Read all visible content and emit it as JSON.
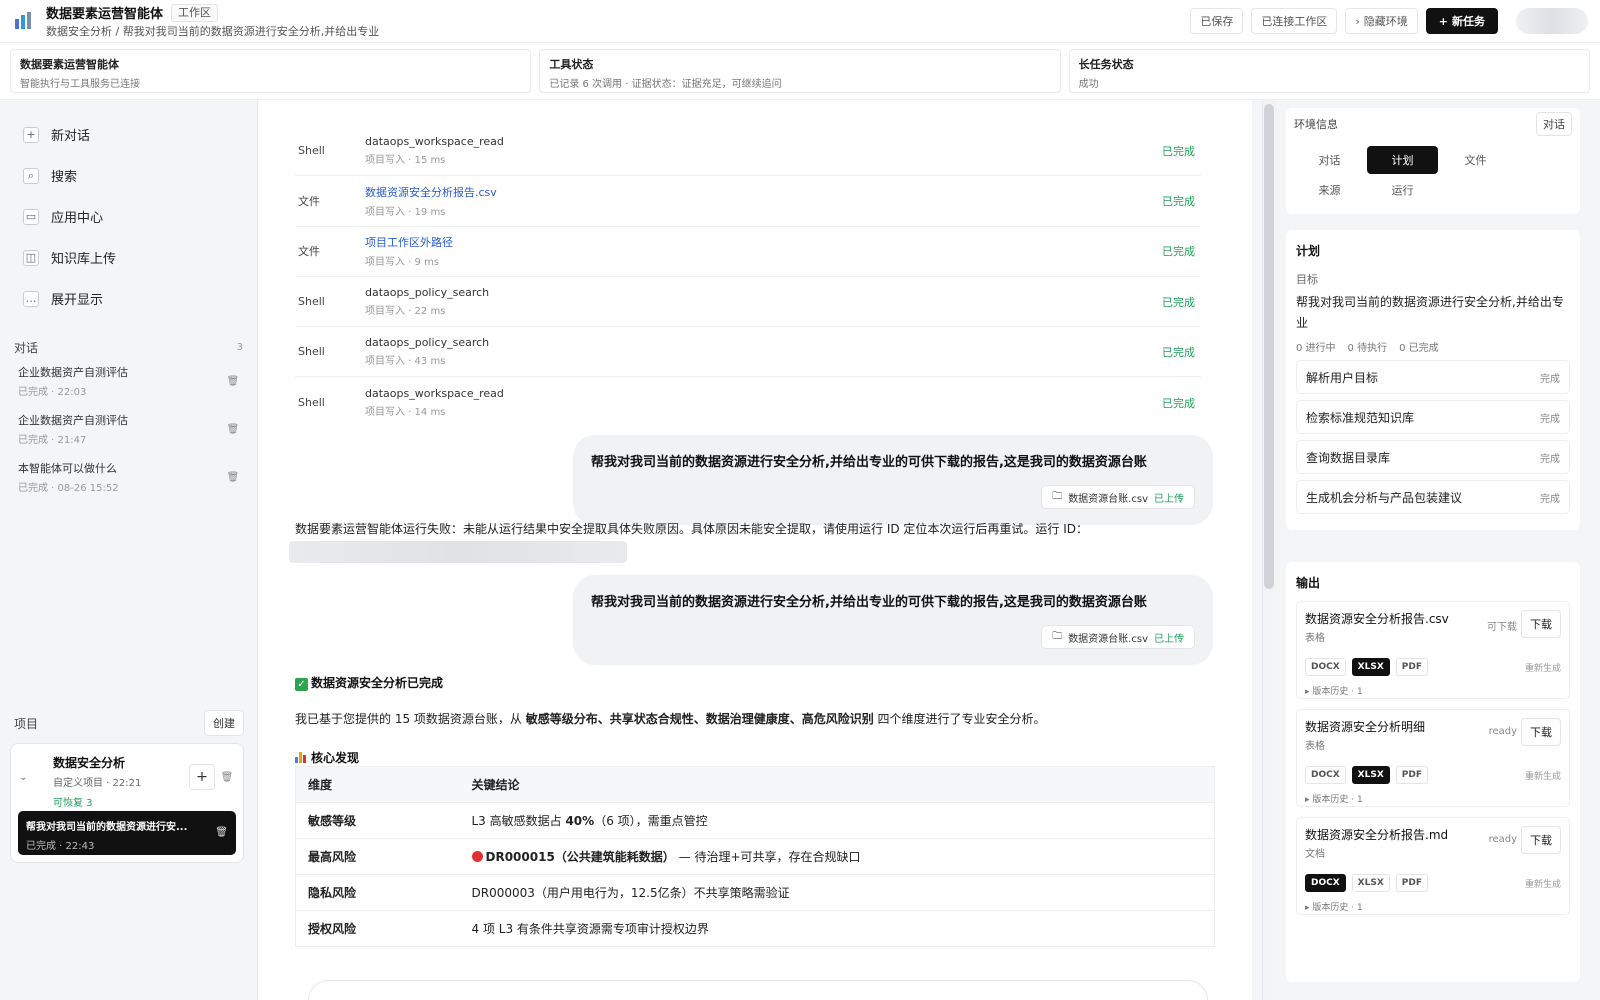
{
  "header": {
    "title": "数据要素运营智能体",
    "workspace_tag": "工作区",
    "breadcrumb": "数据安全分析 / 帮我对我司当前的数据资源进行安全分析,并给出专业",
    "saved": "已保存",
    "connected": "已连接工作区",
    "hide_env": "隐藏环境",
    "new_task": "新任务"
  },
  "status": {
    "agent": {
      "title": "数据要素运营智能体",
      "desc": "智能执行与工具服务已连接"
    },
    "tool": {
      "title": "工具状态",
      "desc": "已记录 6 次调用 · 证据状态：证据充足，可继续追问"
    },
    "task": {
      "title": "长任务状态",
      "desc": "成功"
    }
  },
  "sidebar": {
    "nav": [
      {
        "label": "新对话",
        "icon": "+"
      },
      {
        "label": "搜索",
        "icon": "⌕"
      },
      {
        "label": "应用中心",
        "icon": "▭"
      },
      {
        "label": "知识库上传",
        "icon": "◫"
      },
      {
        "label": "展开显示",
        "icon": "…"
      }
    ],
    "conversations_label": "对话",
    "conversations_count": "3",
    "conversations": [
      {
        "title": "企业数据资产自测评估",
        "sub": "已完成 · 22:03"
      },
      {
        "title": "企业数据资产自测评估",
        "sub": "已完成 · 21:47"
      },
      {
        "title": "本智能体可以做什么",
        "sub": "已完成 · 08-26 15:52"
      }
    ],
    "projects_label": "项目",
    "create": "创建",
    "project": {
      "name": "数据安全分析",
      "sub": "自定义项目 · 22:21",
      "recoverable": "可恢复 3",
      "run_title": "帮我对我司当前的数据资源进行安...",
      "run_sub": "已完成 · 22:43"
    }
  },
  "tools": [
    {
      "type": "Shell",
      "name": "dataops_workspace_read",
      "meta": "项目写入 · 15 ms",
      "status": "已完成",
      "link": false
    },
    {
      "type": "文件",
      "name": "数据资源安全分析报告.csv",
      "meta": "项目写入 · 19 ms",
      "status": "已完成",
      "link": true
    },
    {
      "type": "文件",
      "name": "项目工作区外路径",
      "meta": "项目写入 · 9 ms",
      "status": "已完成",
      "link": true
    },
    {
      "type": "Shell",
      "name": "dataops_policy_search",
      "meta": "项目写入 · 22 ms",
      "status": "已完成",
      "link": false
    },
    {
      "type": "Shell",
      "name": "dataops_policy_search",
      "meta": "项目写入 · 43 ms",
      "status": "已完成",
      "link": false
    },
    {
      "type": "Shell",
      "name": "dataops_workspace_read",
      "meta": "项目写入 · 14 ms",
      "status": "已完成",
      "link": false
    }
  ],
  "messages": {
    "user_text": "帮我对我司当前的数据资源进行安全分析,并给出专业的可供下载的报告,这是我司的数据资源台账",
    "attachment": "数据资源台账.csv",
    "uploaded": "已上传",
    "error": "数据要素运营智能体运行失败：未能从运行结果中安全提取具体失败原因。具体原因未能安全提取，请使用运行 ID 定位本次运行后再重试。运行 ID：",
    "done_title": "数据资源安全分析已完成",
    "summary_pre": "我已基于您提供的 15 项数据资源台账，从 ",
    "summary_bold": "敏感等级分布、共享状态合规性、数据治理健康度、高危风险识别",
    "summary_post": " 四个维度进行了专业安全分析。",
    "core_title": "核心发现"
  },
  "findings": {
    "headers": [
      "维度",
      "关键结论"
    ],
    "rows": [
      {
        "dim": "敏感等级",
        "pre": "L3 高敏感数据占 ",
        "bold": "40%",
        "post": "（6 项），需重点管控"
      },
      {
        "dim": "最高风险",
        "pre": "",
        "bold": "DR000015（公共建筑能耗数据）",
        "post": " — 待治理+可共享，存在合规缺口"
      },
      {
        "dim": "隐私风险",
        "pre": "DR000003（用户用电行为，12.5亿条）不共享策略需验证",
        "bold": "",
        "post": ""
      },
      {
        "dim": "授权风险",
        "pre": "4 项 L3 有条件共享资源需专项审计授权边界",
        "bold": "",
        "post": ""
      }
    ]
  },
  "env": {
    "title": "环境信息",
    "chat_btn": "对话",
    "tabs": [
      "对话",
      "计划",
      "文件",
      "来源",
      "运行"
    ],
    "active_tab": "计划"
  },
  "plan": {
    "title": "计划",
    "goal_label": "目标",
    "goal": "帮我对我司当前的数据资源进行安全分析,并给出专业",
    "counts": [
      "0 进行中",
      "0 待执行",
      "0 已完成"
    ],
    "steps": [
      {
        "name": "解析用户目标",
        "status": "完成"
      },
      {
        "name": "检索标准规范知识库",
        "status": "完成"
      },
      {
        "name": "查询数据目录库",
        "status": "完成"
      },
      {
        "name": "生成机会分析与产品包装建议",
        "status": "完成"
      }
    ]
  },
  "output": {
    "title": "输出",
    "download": "下载",
    "regen": "重新生成",
    "history": "版本历史 · 1",
    "formats": [
      "DOCX",
      "XLSX",
      "PDF"
    ],
    "files": [
      {
        "name": "数据资源安全分析报告.csv",
        "type": "表格",
        "state": "可下载",
        "selected": "XLSX"
      },
      {
        "name": "数据资源安全分析明细",
        "type": "表格",
        "state": "ready",
        "selected": "XLSX"
      },
      {
        "name": "数据资源安全分析报告.md",
        "type": "文档",
        "state": "ready",
        "selected": "DOCX"
      }
    ]
  },
  "colors": {
    "accent": "#111111",
    "success": "#21a05a",
    "link": "#2a5cd6",
    "danger": "#e03131"
  }
}
